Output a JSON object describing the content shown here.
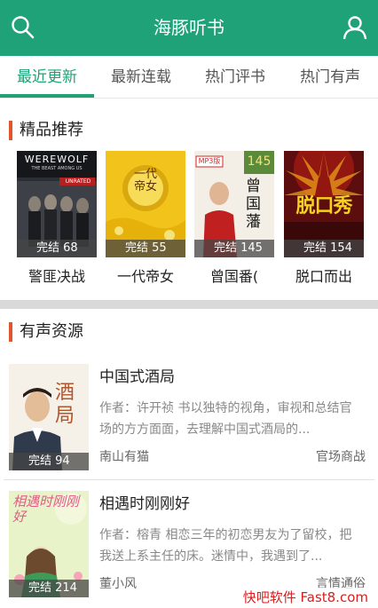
{
  "app": {
    "title": "海豚听书",
    "accent_color": "#1fa277",
    "icons": {
      "search": "search-icon",
      "user": "user-icon"
    }
  },
  "tabs": [
    {
      "label": "最近更新",
      "active": true
    },
    {
      "label": "最新连载",
      "active": false
    },
    {
      "label": "热门评书",
      "active": false
    },
    {
      "label": "热门有声",
      "active": false
    }
  ],
  "featured": {
    "heading": "精品推荐",
    "books": [
      {
        "title": "警匪决战",
        "status": "完结 68",
        "cover_text": "WEREWOLF",
        "cover_sub": "THE BEAST AMONG US",
        "cover_tag": "UNRATED"
      },
      {
        "title": "一代帝女",
        "status": "完结 55",
        "cover_text": "一代帝女"
      },
      {
        "title": "曾国番(",
        "status": "完结 145",
        "cover_text": "曾国藩",
        "cover_tag": "MP3版",
        "cover_num": "145"
      },
      {
        "title": "脱口而出",
        "status": "完结 154",
        "cover_text": "脱口秀"
      }
    ]
  },
  "audio": {
    "heading": "有声资源",
    "items": [
      {
        "title": "中国式酒局",
        "status": "完结 94",
        "cover_text": "酒局",
        "description": "作者：许开祯 书以独特的视角，审视和总结官场的方方面面，去理解中国式酒局的...",
        "author": "南山有猫",
        "category": "官场商战"
      },
      {
        "title": "相遇时刚刚好",
        "status": "完结 214",
        "cover_text": "相遇时刚刚好",
        "description": "作者：榕青 相恋三年的初恋男友为了留校，把我送上系主任的床。迷情中，我遇到了...",
        "author": "董小风",
        "category": "言情通俗"
      }
    ]
  },
  "watermark": "快吧软件 Fast8.com"
}
